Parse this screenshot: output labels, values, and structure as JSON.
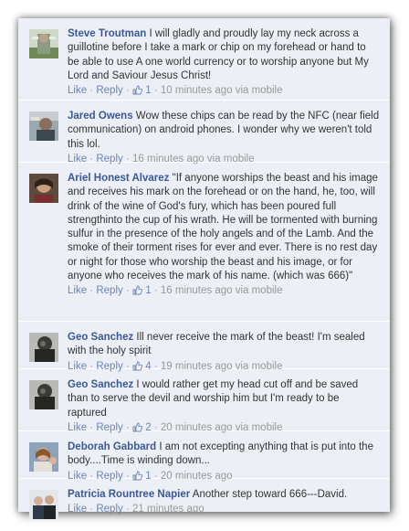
{
  "ui": {
    "like_label": "Like",
    "reply_label": "Reply",
    "separator": "·",
    "like_icon": "thumbs-up-icon",
    "link_color": "#3b5998",
    "action_color": "#6d84b4",
    "background": "#eceff5"
  },
  "comments": [
    {
      "author": "Steve Troutman",
      "text": "I will gladly and proudly lay my neck across a guillotine before I take a mark or chip on my forehead or hand to be able to use A one world currency or to worship anyone but My Lord and Saviour Jesus Christ!",
      "likes": "1",
      "time": "10 minutes ago via mobile"
    },
    {
      "author": "Jared Owens",
      "text": "Wow these chips can be read by the NFC (near field communication) on android phones. I wonder why we weren't told this lol.",
      "likes": "",
      "time": "16 minutes ago via mobile"
    },
    {
      "author": "Ariel Honest Alvarez",
      "text": "\"If anyone worships the beast and his image and receives his mark on the forehead or on the hand, he, too, will drink of the wine of God's fury, which has been poured full strengthinto the cup of his wrath. He will be tormented with burning sulfur in the presence of the holy angels and of the Lamb. And the smoke of their torment rises for ever and ever. There is no rest day or night for those who worship the beast and his image, or for anyone who receives the mark of his name. (which was 666)\"",
      "likes": "1",
      "time": "16 minutes ago via mobile"
    },
    {
      "author": "Geo Sanchez",
      "text": "Ill never receive the mark of the beast! I'm sealed with the holy spirit",
      "likes": "4",
      "time": "19 minutes ago via mobile"
    },
    {
      "author": "Geo Sanchez",
      "text": "I would rather get my head cut off and be saved than to serve the devil and worship him but I'm ready to be raptured",
      "likes": "2",
      "time": "20 minutes ago via mobile"
    },
    {
      "author": "Deborah Gabbard",
      "text": "I am not excepting anything that is put into the body....Time is winding down...",
      "likes": "1",
      "time": "20 minutes ago"
    },
    {
      "author": "Patricia Rountree Napier",
      "text": "Another step toward 666---David.",
      "likes": "",
      "time": "21 minutes ago"
    }
  ]
}
